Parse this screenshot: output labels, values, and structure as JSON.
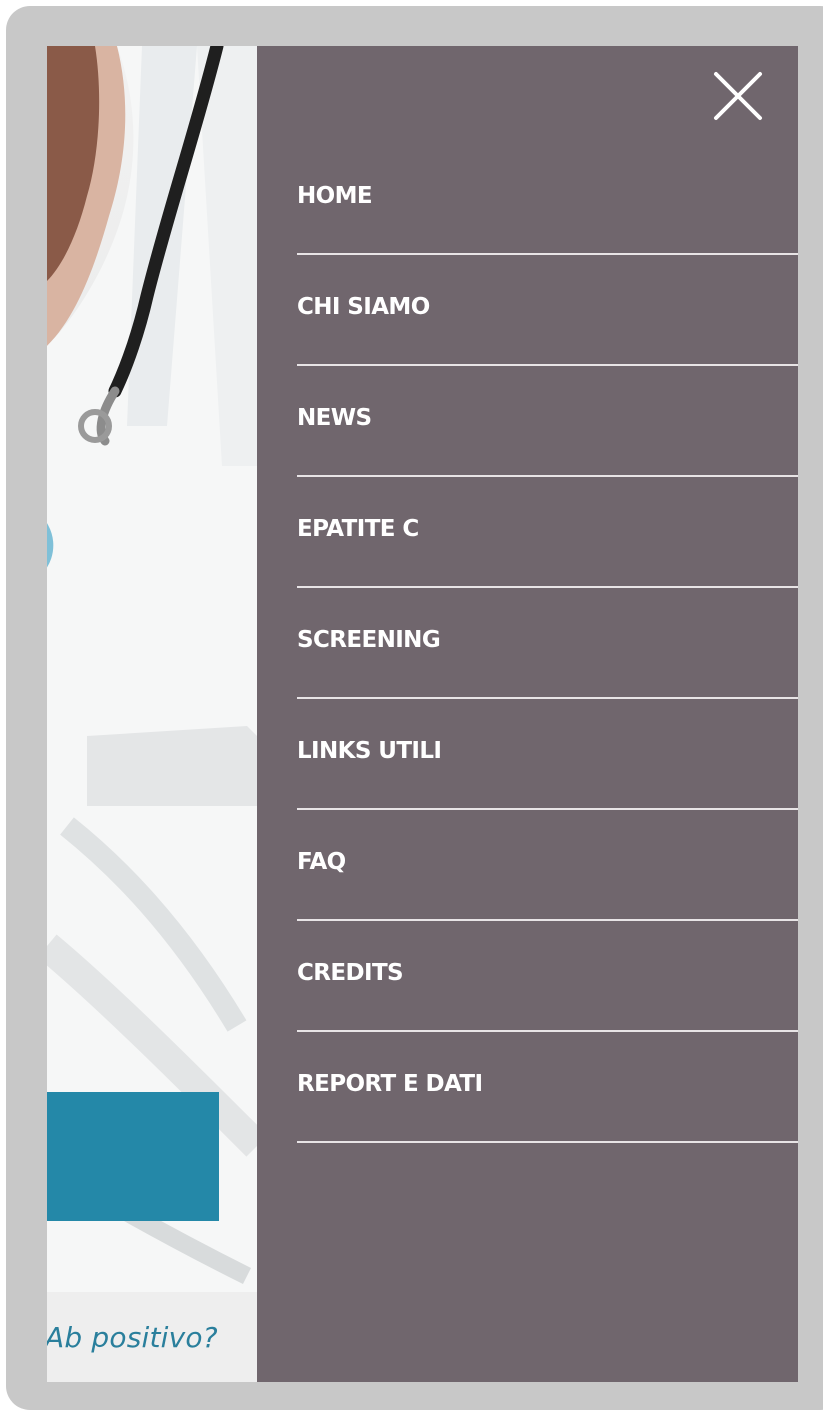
{
  "background": {
    "tagline": "Ab positivo?",
    "cta_color": "#2488a8"
  },
  "menu": {
    "background_color": "#70666d",
    "close_icon": "close-icon",
    "items": [
      {
        "label": "HOME"
      },
      {
        "label": "CHI SIAMO"
      },
      {
        "label": "NEWS"
      },
      {
        "label": "EPATITE C"
      },
      {
        "label": "SCREENING"
      },
      {
        "label": "LINKS UTILI"
      },
      {
        "label": "FAQ"
      },
      {
        "label": "CREDITS"
      },
      {
        "label": "REPORT E DATI"
      }
    ]
  }
}
